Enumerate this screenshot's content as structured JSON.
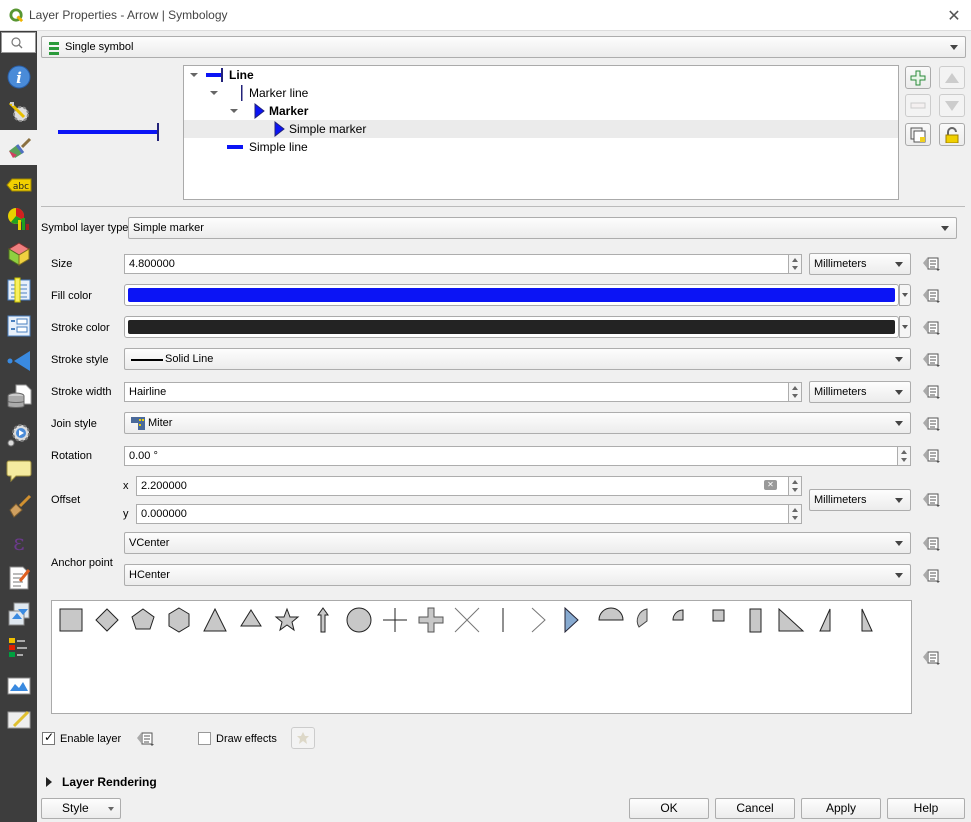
{
  "window": {
    "title": "Layer Properties - Arrow | Symbology",
    "close_icon": "close-icon"
  },
  "sidebar": {
    "search_icon": "search-icon",
    "items": [
      {
        "name": "information",
        "icon": "info-icon"
      },
      {
        "name": "source",
        "icon": "source-settings-icon"
      },
      {
        "name": "symbology",
        "icon": "symbology-brush-icon",
        "active": true
      },
      {
        "name": "labels",
        "icon": "labels-abc-icon"
      },
      {
        "name": "diagrams",
        "icon": "diagrams-icon"
      },
      {
        "name": "3d-view",
        "icon": "3d-cube-icon"
      },
      {
        "name": "source-fields",
        "icon": "fields-icon"
      },
      {
        "name": "attributes-form",
        "icon": "form-icon"
      },
      {
        "name": "joins",
        "icon": "joins-icon"
      },
      {
        "name": "auxiliary-storage",
        "icon": "auxiliary-storage-icon"
      },
      {
        "name": "actions",
        "icon": "actions-icon"
      },
      {
        "name": "display",
        "icon": "display-tooltip-icon"
      },
      {
        "name": "rendering",
        "icon": "rendering-brush-icon"
      },
      {
        "name": "variables",
        "icon": "variables-epsilon-icon"
      },
      {
        "name": "metadata",
        "icon": "metadata-icon"
      },
      {
        "name": "dependencies",
        "icon": "dependencies-icon"
      },
      {
        "name": "legend",
        "icon": "legend-icon"
      },
      {
        "name": "qgis-server",
        "icon": "qgis-server-icon"
      },
      {
        "name": "digitizing",
        "icon": "digitizing-icon"
      }
    ]
  },
  "renderer": {
    "selected": "Single symbol"
  },
  "symbol_tree": [
    {
      "label": "Line",
      "bold": true,
      "level": 0,
      "expanded": true
    },
    {
      "label": "Marker line",
      "bold": false,
      "level": 1,
      "expanded": true
    },
    {
      "label": "Marker",
      "bold": true,
      "level": 2,
      "expanded": true
    },
    {
      "label": "Simple marker",
      "bold": false,
      "level": 3,
      "selected": true
    },
    {
      "label": "Simple line",
      "bold": false,
      "level": 1
    }
  ],
  "tree_buttons": {
    "add": "add-layer-icon",
    "remove": "remove-layer-icon",
    "up": "move-up-icon",
    "down": "move-down-icon",
    "duplicate": "duplicate-icon",
    "lock": "lock-icon"
  },
  "symbol_layer_type": {
    "label": "Symbol layer type",
    "value": "Simple marker"
  },
  "fields": {
    "size": {
      "label": "Size",
      "value": "4.800000",
      "unit": "Millimeters"
    },
    "fill_color": {
      "label": "Fill color",
      "color": "#0b14f5"
    },
    "stroke_color": {
      "label": "Stroke color",
      "color": "#232323"
    },
    "stroke_style": {
      "label": "Stroke style",
      "value": "Solid Line"
    },
    "stroke_width": {
      "label": "Stroke width",
      "value": "Hairline",
      "unit": "Millimeters"
    },
    "join_style": {
      "label": "Join style",
      "value": "Miter"
    },
    "rotation": {
      "label": "Rotation",
      "value": "0.00 °"
    },
    "offset": {
      "label": "Offset",
      "x_label": "x",
      "x_value": "2.200000",
      "y_label": "y",
      "y_value": "0.000000",
      "unit": "Millimeters"
    },
    "anchor": {
      "label": "Anchor point",
      "vertical": "VCenter",
      "horizontal": "HCenter"
    }
  },
  "shapes": [
    "square",
    "diamond",
    "pentagon",
    "hexagon",
    "triangle",
    "equilateral-triangle",
    "star",
    "arrow",
    "circle",
    "cross",
    "cross-fill",
    "cross2",
    "line",
    "arrowhead",
    "filled-arrowhead",
    "semi-circle",
    "third-circle",
    "quarter-circle",
    "quarter-square",
    "half-square",
    "diagonal-half-square",
    "right-half-triangle",
    "left-half-triangle"
  ],
  "selected_shape": "filled-arrowhead",
  "enable_layer": {
    "label": "Enable layer",
    "checked": true
  },
  "draw_effects": {
    "label": "Draw effects",
    "checked": false
  },
  "layer_rendering": {
    "label": "Layer Rendering"
  },
  "footer": {
    "style": "Style",
    "ok": "OK",
    "cancel": "Cancel",
    "apply": "Apply",
    "help": "Help"
  }
}
